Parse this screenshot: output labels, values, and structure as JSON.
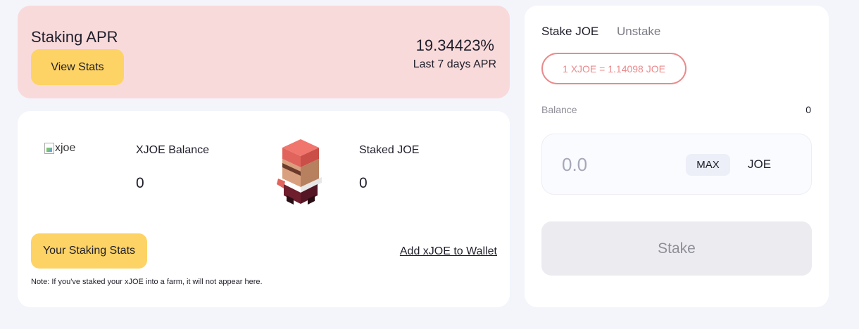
{
  "apr": {
    "title": "Staking APR",
    "view_stats_label": "View Stats",
    "value": "19.34423%",
    "caption": "Last 7 days APR"
  },
  "balances": {
    "xjoe_image_alt": "xjoe",
    "xjoe_label": "XJOE Balance",
    "xjoe_value": "0",
    "staked_label": "Staked JOE",
    "staked_value": "0",
    "your_stats_label": "Your Staking Stats",
    "add_wallet_label": "Add xJOE to Wallet",
    "note": "Note: If you've staked your xJOE into a farm, it will not appear here."
  },
  "stake_panel": {
    "tabs": [
      {
        "label": "Stake JOE",
        "active": true
      },
      {
        "label": "Unstake",
        "active": false
      }
    ],
    "rate": "1 XJOE = 1.14098 JOE",
    "balance_label": "Balance",
    "balance_value": "0",
    "amount_placeholder": "0.0",
    "max_label": "MAX",
    "token": "JOE",
    "submit_label": "Stake"
  },
  "colors": {
    "page_bg": "#f3f5fb",
    "apr_card_bg": "#f9dadb",
    "button_yellow": "#fdd365",
    "rate_accent": "#ea8a8c",
    "disabled_button": "#ececf0"
  }
}
